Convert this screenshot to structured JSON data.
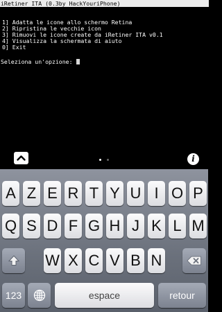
{
  "terminal": {
    "title": "iRetiner ITA (0.3by HackYouriPhone)",
    "menu_items": [
      "1] Adatta le icone allo schermo Retina",
      "2] Ripristina le vecchie icon",
      "3] Rimuovi le icone create da iRetiner ITA v0.1",
      "4] Visualizza la schermata di aiuto",
      "0] Exit"
    ],
    "prompt": "Seleziona un'opzione: "
  },
  "toolbar": {
    "keyboard_toggle_icon": "chevron-up-icon",
    "info_label": "i",
    "page_indicator": {
      "pages": 2,
      "current": 1
    }
  },
  "keyboard": {
    "row1": [
      "A",
      "Z",
      "E",
      "R",
      "T",
      "Y",
      "U",
      "I",
      "O",
      "P"
    ],
    "row2": [
      "Q",
      "S",
      "D",
      "F",
      "G",
      "H",
      "J",
      "K",
      "L",
      "M"
    ],
    "row3": [
      "W",
      "X",
      "C",
      "V",
      "B",
      "N"
    ],
    "numbers_label": "123",
    "space_label": "espace",
    "return_label": "retour",
    "icons": {
      "shift": "shift-icon",
      "backspace": "backspace-icon",
      "globe": "globe-icon"
    }
  },
  "colors": {
    "terminal_bg": "#000000",
    "terminal_text": "#ffffff",
    "keyboard_bg": "#6b717c",
    "key_light": "#f4f4f6",
    "key_dark": "#8a909c"
  }
}
